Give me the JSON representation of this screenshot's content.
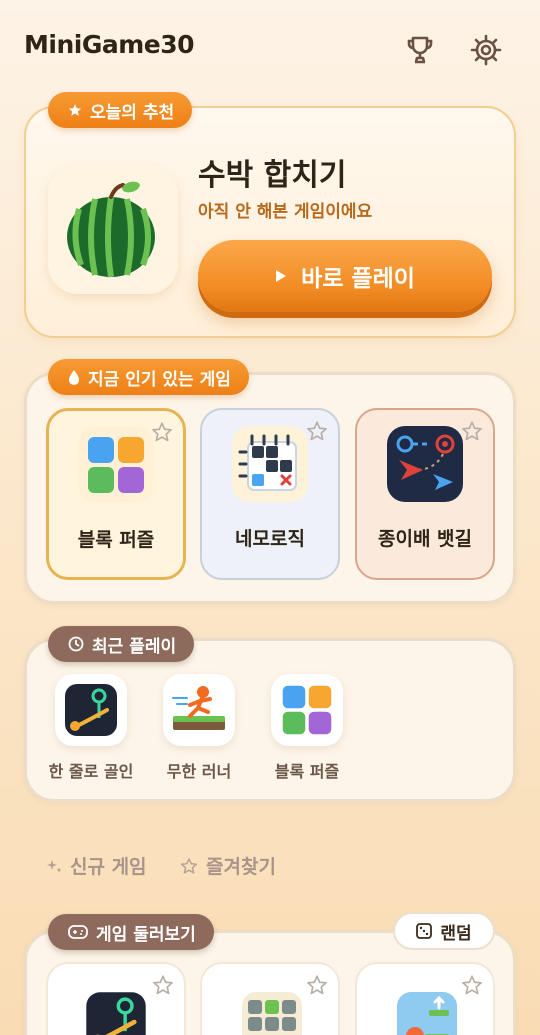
{
  "header": {
    "app_title": "MiniGame30",
    "trophy_icon": "trophy-icon",
    "settings_icon": "gear-icon"
  },
  "featured": {
    "badge": "오늘의 추천",
    "title": "수박 합치기",
    "subtitle": "아직 안 해본 게임이에요",
    "play_label": "바로 플레이",
    "icon": "watermelon-icon"
  },
  "popular": {
    "badge": "지금 인기 있는 게임",
    "games": [
      {
        "label": "블록 퍼즐",
        "icon": "block-puzzle-icon"
      },
      {
        "label": "네모로직",
        "icon": "nonogram-icon"
      },
      {
        "label": "종이배 뱃길",
        "icon": "paper-boat-icon"
      }
    ]
  },
  "recent": {
    "badge": "최근 플레이",
    "games": [
      {
        "label": "한 줄로 골인",
        "icon": "one-line-goal-icon"
      },
      {
        "label": "무한 러너",
        "icon": "infinite-runner-icon"
      },
      {
        "label": "블록 퍼즐",
        "icon": "block-puzzle-icon"
      }
    ]
  },
  "tabs": [
    {
      "label": "신규 게임",
      "icon": "sparkle-icon"
    },
    {
      "label": "즐겨찾기",
      "icon": "star-icon"
    }
  ],
  "browse": {
    "badge": "게임 둘러보기",
    "random_label": "랜덤"
  },
  "colors": {
    "accent_orange": "#f18a22",
    "brown_badge": "#8d6a5c",
    "subtitle_orange": "#b8691c"
  }
}
